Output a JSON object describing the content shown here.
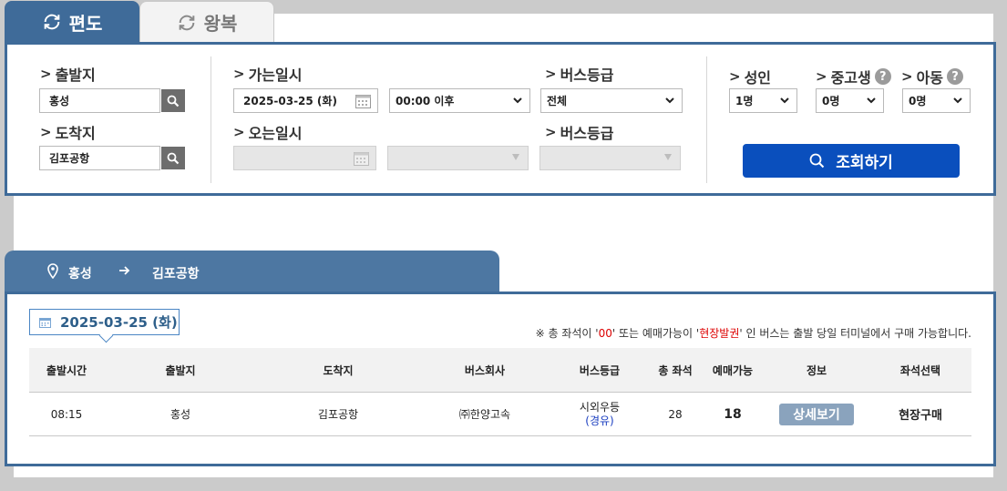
{
  "tabs": {
    "oneway": "편도",
    "roundtrip": "왕복"
  },
  "search": {
    "departure_label": "출발지",
    "departure_value": "홍성",
    "arrival_label": "도착지",
    "arrival_value": "김포공항",
    "go_date_label": "가는일시",
    "go_date_value": "2025-03-25 (화)",
    "go_time_value": "00:00 이후",
    "go_grade_label": "버스등급",
    "go_grade_value": "전체",
    "return_date_label": "오는일시",
    "return_grade_label": "버스등급",
    "adult_label": "성인",
    "adult_value": "1명",
    "teen_label": "중고생",
    "teen_value": "0명",
    "child_label": "아동",
    "child_value": "0명",
    "query_button": "조회하기"
  },
  "route": {
    "from": "홍성",
    "to": "김포공항"
  },
  "results": {
    "date": "2025-03-25 (화)",
    "notice": {
      "prefix": "※ 총 좌석이 '",
      "zero": "00",
      "middle": "' 또는 예매가능이 '",
      "onsite": "현장발권",
      "suffix": "' 인 버스는 출발 당일 터미널에서 구매 가능합니다."
    },
    "columns": [
      "출발시간",
      "출발지",
      "도착지",
      "버스회사",
      "버스등급",
      "총 좌석",
      "예매가능",
      "정보",
      "좌석선택"
    ],
    "rows": [
      {
        "time": "08:15",
        "from": "홍성",
        "to": "김포공항",
        "company": "㈜한양고속",
        "grade": "시외우등",
        "route_type": "(경유)",
        "total_seats": "28",
        "available": "18",
        "info_button": "상세보기",
        "seat_select": "현장구매"
      }
    ]
  },
  "colors": {
    "panel_border": "#3f6b99",
    "active_tab": "#3f6b99",
    "route_header": "#4d77a2",
    "query_button": "#0a4fbd",
    "detail_button": "#8aa3bd",
    "notice_highlight": "#dd0000",
    "route_type": "#1a3ec0"
  },
  "icons": {
    "tab": "refresh-icon",
    "search": "magnifier-icon",
    "date": "calendar-icon",
    "route_from": "location-pin-icon",
    "route_arrow": "arrow-right-icon",
    "help": "question-icon"
  }
}
